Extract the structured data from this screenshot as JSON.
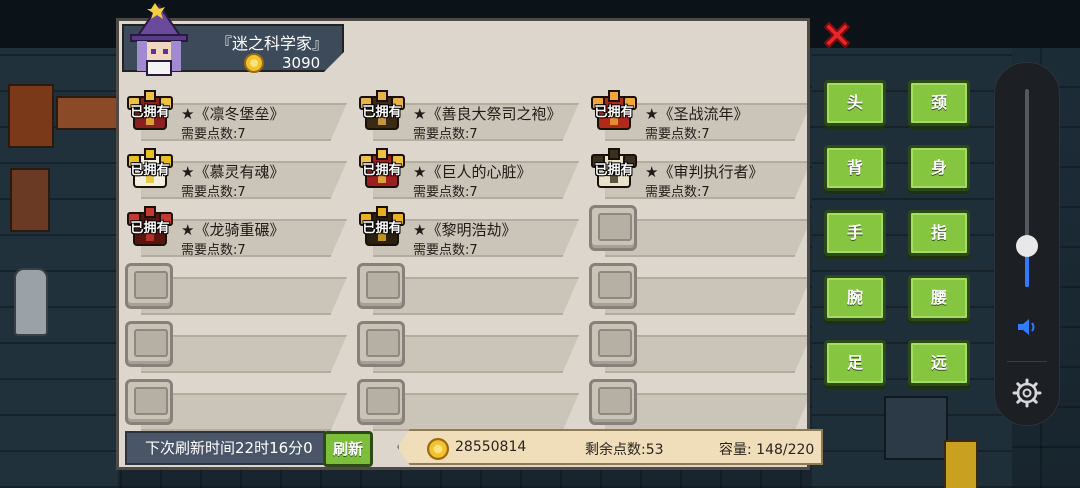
{
  "character": {
    "title": "『迷之科学家』",
    "gold": "3090"
  },
  "items": [
    {
      "name": "★《凛冬堡垒》",
      "req": "需要点数:7",
      "owned": "已拥有",
      "icon": "winter-fortress-armor-icon",
      "c1": "#8b1e1e",
      "c2": "#f0c040"
    },
    {
      "name": "★《善良大祭司之袍》",
      "req": "需要点数:7",
      "owned": "已拥有",
      "icon": "high-priest-robe-icon",
      "c1": "#3a2a14",
      "c2": "#e8b24a"
    },
    {
      "name": "★《圣战流年》",
      "req": "需要点数:7",
      "owned": "已拥有",
      "icon": "crusade-years-armor-icon",
      "c1": "#b02a1a",
      "c2": "#f2a63a"
    },
    {
      "name": "★《慕灵有魂》",
      "req": "需要点数:7",
      "owned": "已拥有",
      "icon": "spirit-soul-robe-icon",
      "c1": "#f4f0e0",
      "c2": "#e6c020"
    },
    {
      "name": "★《巨人的心脏》",
      "req": "需要点数:7",
      "owned": "已拥有",
      "icon": "giant-heart-armor-icon",
      "c1": "#9c1e1e",
      "c2": "#f0c040"
    },
    {
      "name": "★《审判执行者》",
      "req": "需要点数:7",
      "owned": "已拥有",
      "icon": "judgement-executor-robe-icon",
      "c1": "#e8e2c8",
      "c2": "#3a3020"
    },
    {
      "name": "★《龙骑重碾》",
      "req": "需要点数:7",
      "owned": "已拥有",
      "icon": "dragon-knight-armor-icon",
      "c1": "#5a1410",
      "c2": "#c43a30"
    },
    {
      "name": "★《黎明浩劫》",
      "req": "需要点数:7",
      "owned": "已拥有",
      "icon": "dawn-havoc-armor-icon",
      "c1": "#2a2010",
      "c2": "#e8b020"
    }
  ],
  "empty_slots": 10,
  "bottom": {
    "refresh_time": "下次刷新时间22时16分0",
    "refresh_button": "刷新",
    "coins": "28550814",
    "remaining_points": "剩余点数:53",
    "capacity": "容量:  148/220"
  },
  "slot_buttons": [
    "头",
    "颈",
    "背",
    "身",
    "手",
    "指",
    "腕",
    "腰",
    "足",
    "远"
  ],
  "colors": {
    "panel": "#dcd6cc",
    "button_green": "#86c540",
    "close_red": "#e8262a",
    "accent_blue": "#2f7cff"
  }
}
